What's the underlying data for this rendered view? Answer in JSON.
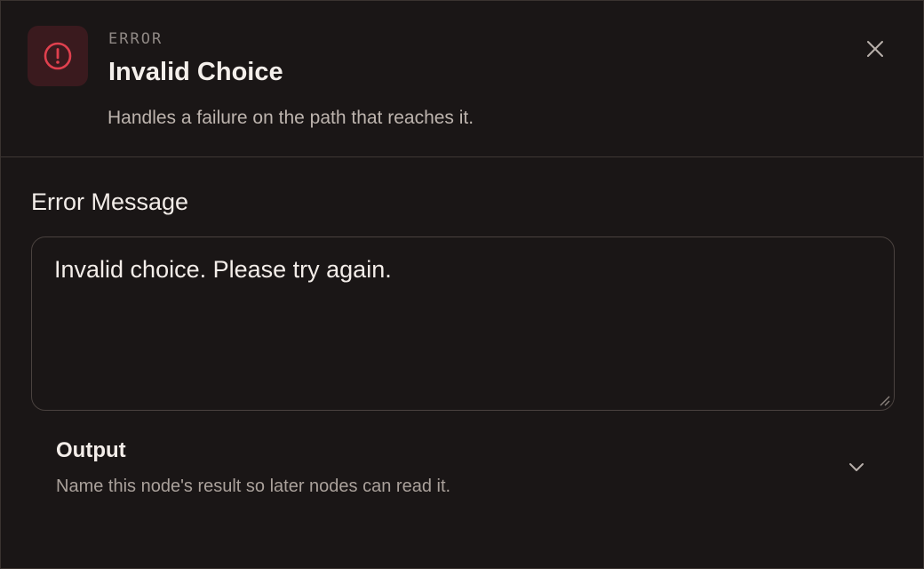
{
  "header": {
    "kicker": "ERROR",
    "title": "Invalid Choice",
    "subtitle": "Handles a failure on the path that reaches it.",
    "icon": "alert-circle-icon",
    "close_icon": "close-icon"
  },
  "error_message": {
    "label": "Error Message",
    "value": "Invalid choice. Please try again."
  },
  "output": {
    "title": "Output",
    "description": "Name this node's result so later nodes can read it.",
    "icon": "chevron-down-icon"
  },
  "colors": {
    "background": "#1a1616",
    "accent_error": "#e0404e",
    "icon_tile_bg": "#3a1a1e"
  }
}
